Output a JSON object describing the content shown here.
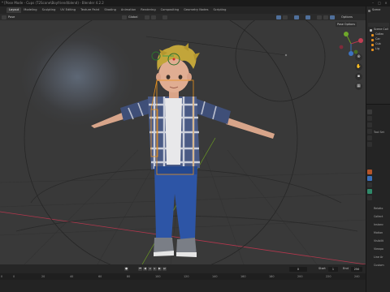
{
  "window": {
    "title": "* [Pose Mode - Cups (T2Scone\\Boyfriend\\blend) - Blender 4.2.2"
  },
  "workspace_tabs": [
    "Layout",
    "Modeling",
    "Sculpting",
    "UV Editing",
    "Texture Paint",
    "Shading",
    "Animation",
    "Rendering",
    "Compositing",
    "Geometry Nodes",
    "Scripting"
  ],
  "active_tab": "Layout",
  "header": {
    "mode": "Pose",
    "transform": "Global",
    "options": "Options"
  },
  "viewport": {
    "pose_options": "Pose Options"
  },
  "timeline": {
    "current_frame": "0",
    "start_label": "Start",
    "start_value": "1",
    "end_label": "End",
    "end_value": "250",
    "ruler_ticks": [
      "0",
      "20",
      "40",
      "60",
      "80",
      "100",
      "120",
      "140",
      "160",
      "180",
      "200",
      "220",
      "240"
    ]
  },
  "right": {
    "outliner_title": "Scene",
    "outliner_items": [
      "Scene Coll",
      "Collec",
      "Car",
      "Cub",
      "Lig"
    ],
    "props_rows": [
      "Tool Set",
      "Relatio",
      "Collect",
      "Instanc",
      "Motion",
      "Visibilit",
      "Viewpo",
      "Line Ar",
      "Custom"
    ]
  },
  "colors": {
    "accent": "#4772b3",
    "selection": "#e8911e",
    "x_axis": "#b3374d",
    "y_axis": "#6a9a23"
  },
  "icons": [
    "cursor-icon",
    "move-icon",
    "rotate-icon",
    "scale-icon",
    "transform-icon",
    "annotate-icon",
    "measure-icon",
    "zoom-icon",
    "pan-icon",
    "camera-icon",
    "grid-icon",
    "play-icon",
    "jump-start-icon",
    "jump-end-icon"
  ]
}
